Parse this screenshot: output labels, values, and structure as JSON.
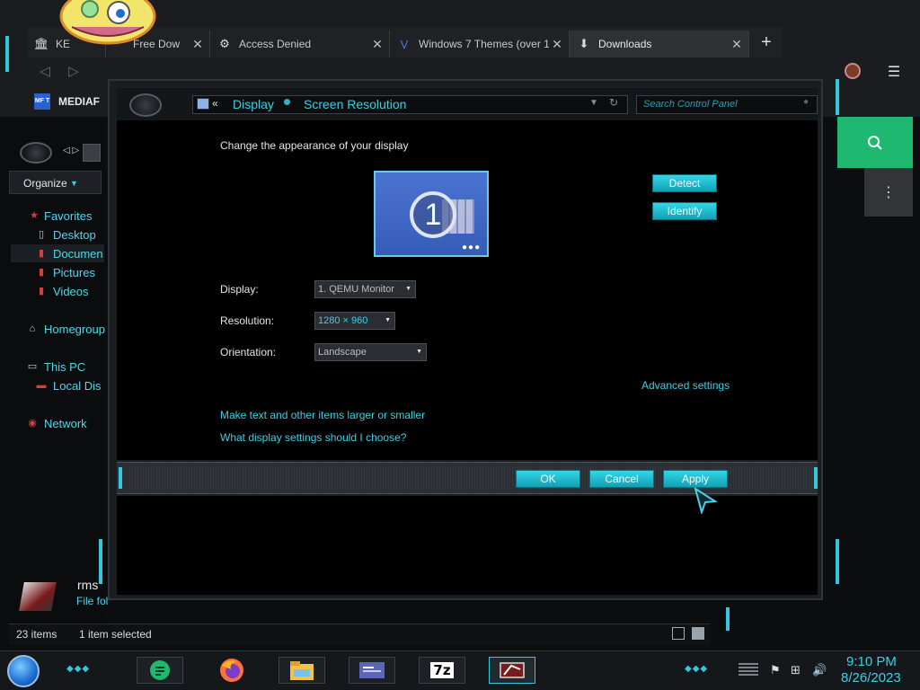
{
  "browser": {
    "tabs": [
      {
        "label": "KE",
        "icon": "bank-icon"
      },
      {
        "label": "Free Dow",
        "icon": "sticker-icon"
      },
      {
        "label": "Access Denied",
        "icon": "puzzle-icon"
      },
      {
        "label": "Windows 7 Themes (over 1",
        "icon": "v-logo-icon"
      },
      {
        "label": "Downloads",
        "icon": "download-icon"
      }
    ],
    "bookmark": {
      "label": "MEDIAF",
      "icon_text": "MF T"
    }
  },
  "explorer": {
    "organize_label": "Organize",
    "nav": {
      "favorites": "Favorites",
      "desktop": "Desktop",
      "documents": "Documen",
      "pictures": "Pictures",
      "videos": "Videos",
      "homegroup": "Homegroup",
      "this_pc": "This PC",
      "local_disk": "Local Dis",
      "network": "Network"
    },
    "details": {
      "name": "rms",
      "type": "File fol"
    },
    "status": {
      "count": "23 items",
      "selected": "1 item selected"
    }
  },
  "dialog": {
    "address": {
      "part1": "Display",
      "part2": "Screen Resolution"
    },
    "search_placeholder": "Search Control Panel",
    "heading": "Change the appearance of your display",
    "monitor_number": "1",
    "detect_label": "Detect",
    "identify_label": "Identify",
    "display_label": "Display:",
    "display_value": "1. QEMU Monitor",
    "resolution_label": "Resolution:",
    "resolution_value": "1280 × 960",
    "orientation_label": "Orientation:",
    "orientation_value": "Landscape",
    "advanced_link": "Advanced settings",
    "link_text_size": "Make text and other items larger or smaller",
    "link_display_help": "What display settings should I choose?",
    "ok_label": "OK",
    "cancel_label": "Cancel",
    "apply_label": "Apply"
  },
  "taskbar": {
    "clock_time": "9:10 PM",
    "clock_date": "8/26/2023",
    "apps": [
      {
        "name": "notes-app-icon"
      },
      {
        "name": "firefox-icon"
      },
      {
        "name": "file-explorer-icon"
      },
      {
        "name": "control-panel-icon"
      },
      {
        "name": "7zip-icon",
        "label": "7z"
      },
      {
        "name": "display-settings-icon"
      }
    ]
  },
  "colors": {
    "accent": "#31c8dc",
    "link": "#3ad0e4",
    "green": "#1eb871"
  }
}
